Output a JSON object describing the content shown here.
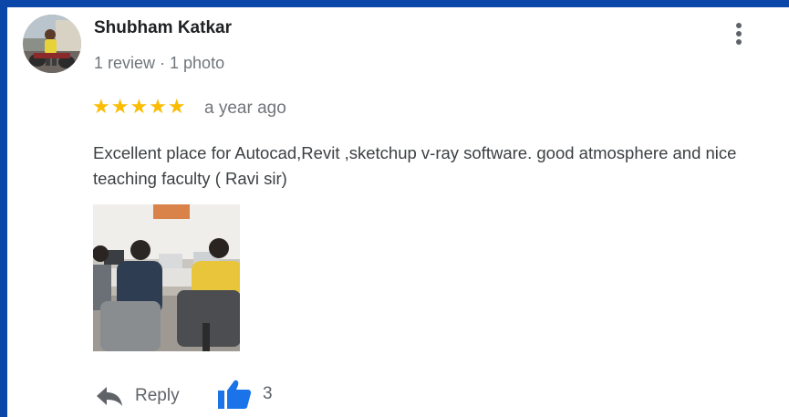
{
  "reviewer": {
    "name": "Shubham Katkar",
    "meta": "1 review · 1 photo"
  },
  "review": {
    "rating": 5,
    "stars_text": "★★★★★",
    "time": "a year ago",
    "text": "Excellent place for Autocad,Revit ,sketchup v-ray software. good atmosphere and nice teaching faculty ( Ravi sir)"
  },
  "actions": {
    "reply_label": "Reply",
    "like_count": "3"
  },
  "icons": {
    "menu": "more-vert-icon",
    "reply": "reply-arrow-icon",
    "like": "thumbs-up-icon"
  },
  "colors": {
    "frame_border": "#0b47a8",
    "star": "#fbbc04",
    "like_icon": "#1a73e8"
  }
}
